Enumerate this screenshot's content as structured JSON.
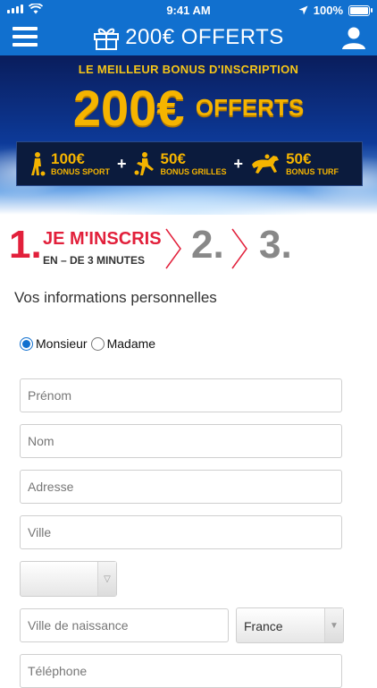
{
  "status_bar": {
    "time": "9:41 AM",
    "battery": "100%"
  },
  "navbar": {
    "title": "200€ OFFERTS"
  },
  "banner": {
    "subtitle": "LE MEILLEUR BONUS D'INSCRIPTION",
    "amount": "200€",
    "offert": "OFFERTS",
    "bonuses": [
      {
        "value": "100€",
        "label": "BONUS SPORT"
      },
      {
        "value": "50€",
        "label": "BONUS GRILLES"
      },
      {
        "value": "50€",
        "label": "BONUS TURF"
      }
    ],
    "plus": "+"
  },
  "steps": {
    "step1_number": "1.",
    "step1_title": "JE M'INSCRIS",
    "step1_subtitle": "EN – DE 3 MINUTES",
    "step2_number": "2.",
    "step3_number": "3."
  },
  "form": {
    "section_title": "Vos informations personnelles",
    "civility": {
      "option1": "Monsieur",
      "option2": "Madame"
    },
    "prenom_placeholder": "Prénom",
    "nom_placeholder": "Nom",
    "adresse_placeholder": "Adresse",
    "ville_placeholder": "Ville",
    "birth_city_placeholder": "Ville de naissance",
    "country_value": "France",
    "telephone_placeholder": "Téléphone"
  },
  "colors": {
    "brand_blue": "#1170cf",
    "accent_red": "#e2203b",
    "gold": "#f5b400"
  }
}
